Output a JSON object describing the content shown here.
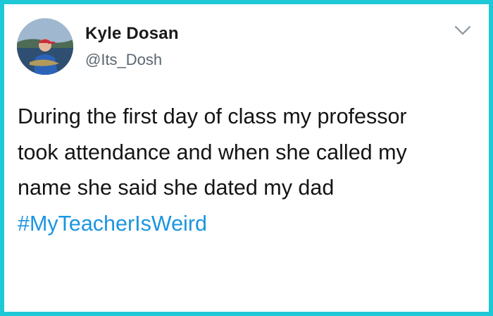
{
  "user": {
    "display_name": "Kyle Dosan",
    "handle": "@Its_Dosh"
  },
  "tweet": {
    "lines": [
      "During the first day of class my professor",
      "took attendance and when she called my",
      "name she said she dated my dad"
    ],
    "hashtag": "#MyTeacherIsWeird"
  },
  "icons": {
    "menu": "chevron-down-icon"
  },
  "colors": {
    "frame_border": "#1fc8d6",
    "hashtag": "#1b95e0",
    "handle": "#5a6670",
    "text": "#141414"
  }
}
